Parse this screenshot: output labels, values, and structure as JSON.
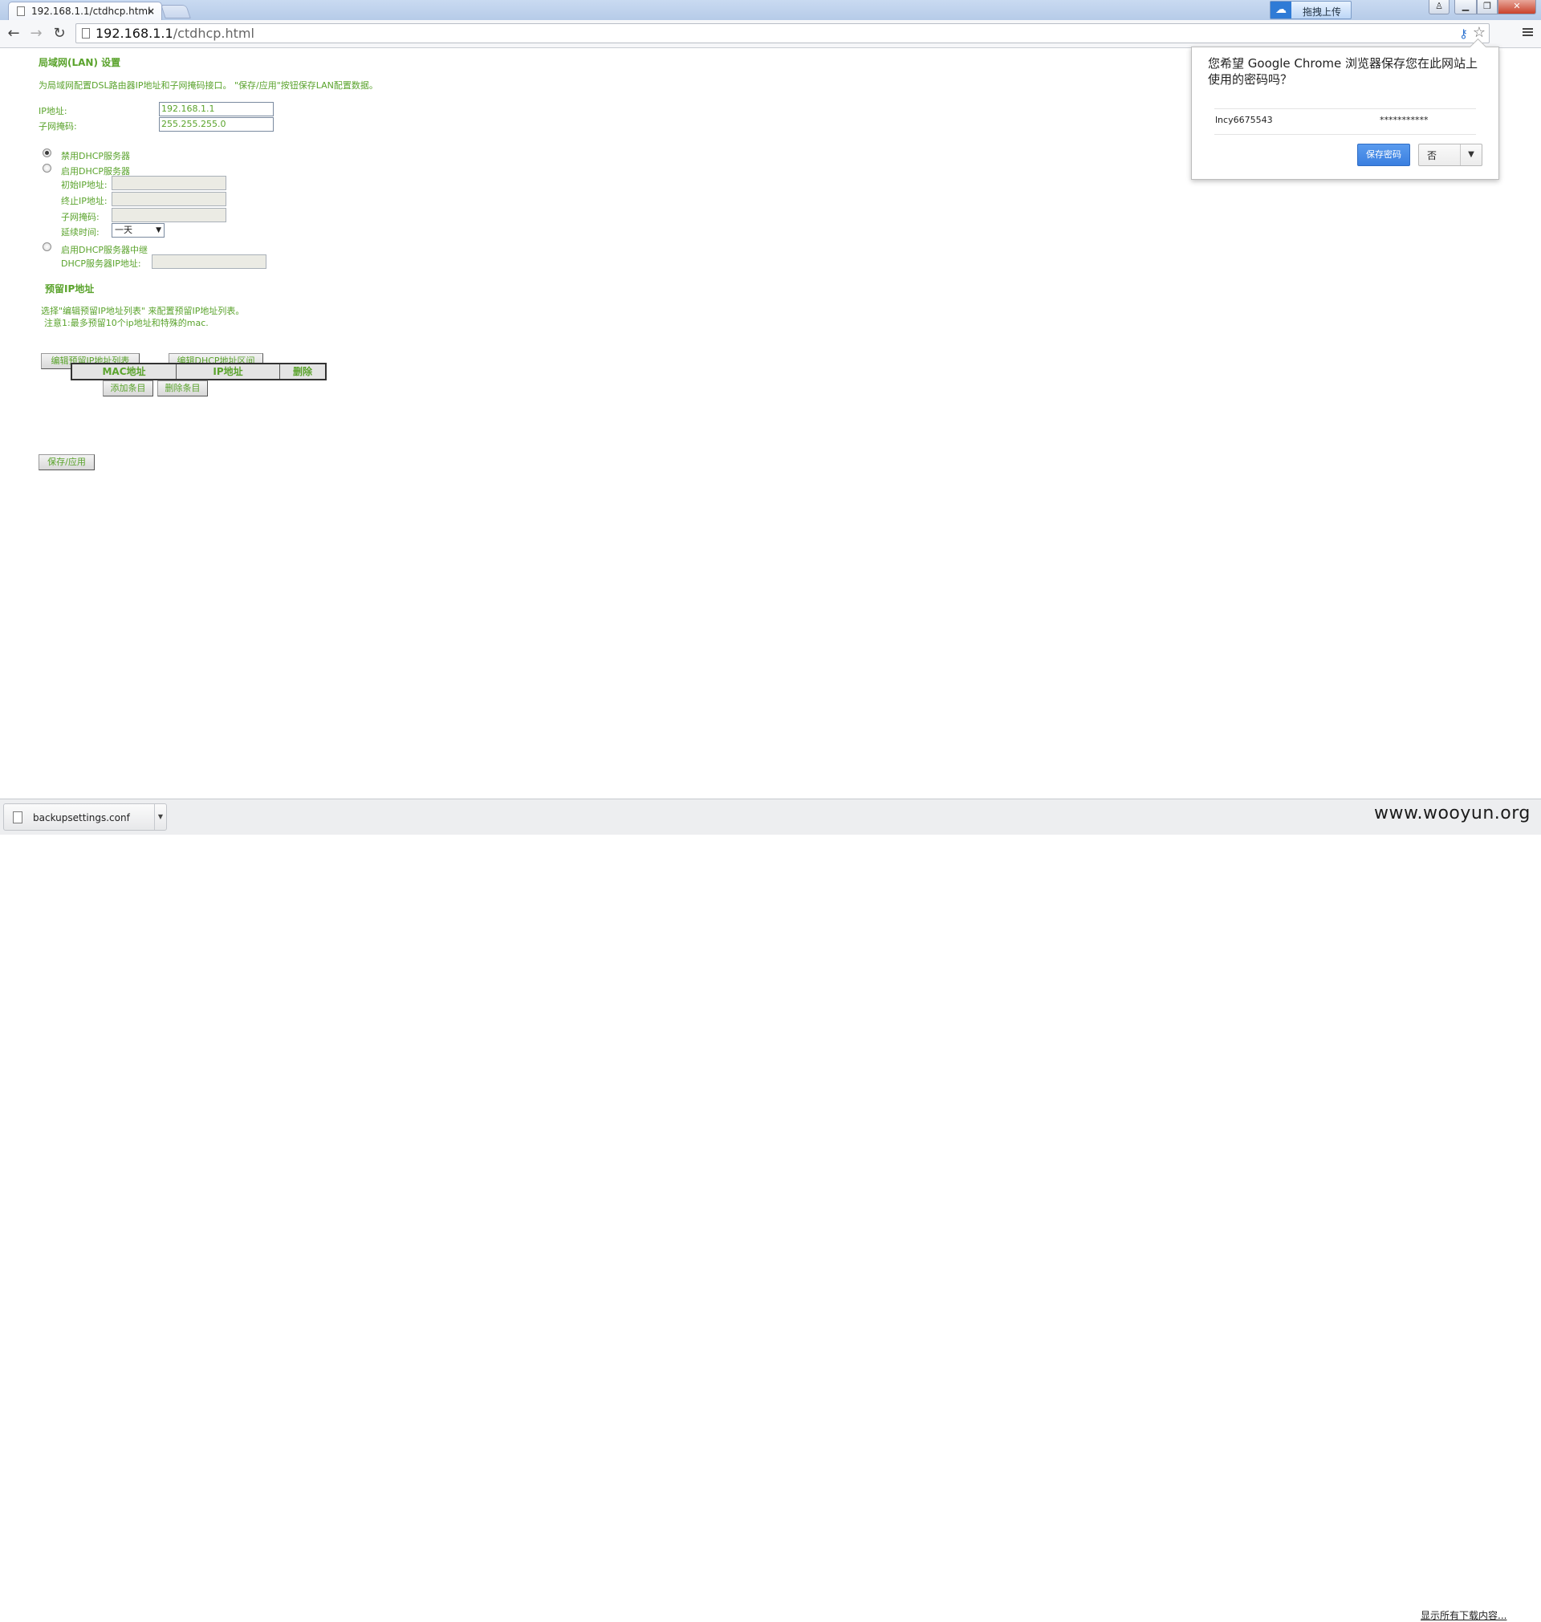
{
  "browser": {
    "tab_title": "192.168.1.1/ctdhcp.html",
    "tab_close": "×",
    "upload_button": "拖拽上传",
    "url_host": "192.168.1.1",
    "url_path": "/ctdhcp.html"
  },
  "page": {
    "title": "局域网(LAN) 设置",
    "description": "为局域网配置DSL路由器IP地址和子网掩码接口。 \"保存/应用\"按钮保存LAN配置数据。",
    "ip_label": "IP地址:",
    "ip_value": "192.168.1.1",
    "mask_label": "子网掩码:",
    "mask_value": "255.255.255.0",
    "dhcp_disable_label": "禁用DHCP服务器",
    "dhcp_enable_label": "启用DHCP服务器",
    "start_ip_label": "初始IP地址:",
    "end_ip_label": "终止IP地址:",
    "dhcp_mask_label": "子网掩码:",
    "lease_label": "延续时间:",
    "lease_value": "一天",
    "relay_label": "启用DHCP服务器中继",
    "relay_ip_label": "DHCP服务器IP地址:",
    "reserved_title": "预留IP地址",
    "reserved_desc_1": "选择\"编辑预留IP地址列表\" 来配置预留IP地址列表。",
    "reserved_desc_2": "注意1:最多预留10个ip地址和特殊的mac.",
    "edit_reserved_button": "编辑预留IP地址列表",
    "edit_range_button": "编辑DHCP地址区间",
    "table_headers": [
      "MAC地址",
      "IP地址",
      "删除"
    ],
    "add_entry_button": "添加条目",
    "delete_entry_button": "删除条目",
    "save_apply_button": "保存/应用"
  },
  "password_bubble": {
    "question": "您希望 Google Chrome 浏览器保存您在此网站上使用的密码吗？",
    "username": "lncy6675543",
    "password_mask": "***********",
    "save_button": "保存密码",
    "no_button": "否"
  },
  "download_shelf": {
    "file_name": "backupsettings.conf",
    "show_all": "显示所有下载内容...",
    "watermark": "www.wooyun.org"
  },
  "colors": {
    "content_text": "#5aa32c",
    "save_button": "#3a7fe0"
  }
}
